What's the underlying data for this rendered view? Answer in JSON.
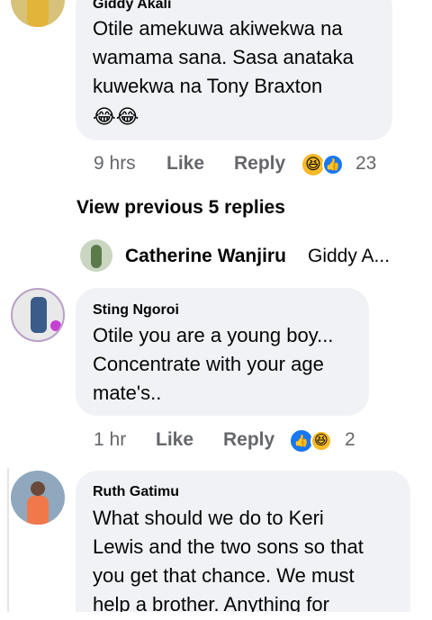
{
  "comments": [
    {
      "author": "Giddy Akali",
      "text": "Otile amekuwa akiwekwa na\nwamama sana. Sasa anataka\nkuwekwa na Tony Braxton",
      "emoji": "😂😂",
      "time": "9 hrs",
      "like": "Like",
      "reply": "Reply",
      "reactions": [
        "haha-icon",
        "like-icon"
      ],
      "reaction_count": "23"
    },
    {
      "author": "Sting Ngoroi",
      "text": "Otile you are a young boy...\nConcentrate with your age\nmate's..",
      "time": "1 hr",
      "like": "Like",
      "reply": "Reply",
      "reactions": [
        "like-icon",
        "haha-icon"
      ],
      "reaction_count": "2"
    },
    {
      "author": "Ruth Gatimu",
      "text": "What should we do to Keri\nLewis and the two sons so that\nyou get that chance. We must\nhelp a brother. Anything for"
    }
  ],
  "view_previous": "View previous 5 replies",
  "reply_preview": {
    "author": "Catherine Wanjiru",
    "snippet": "Giddy A..."
  },
  "colors": {
    "bubble": "#f0f2f5",
    "like_blue": "#1877f2",
    "haha_yellow": "#f7b928",
    "meta_gray": "#65676b"
  }
}
